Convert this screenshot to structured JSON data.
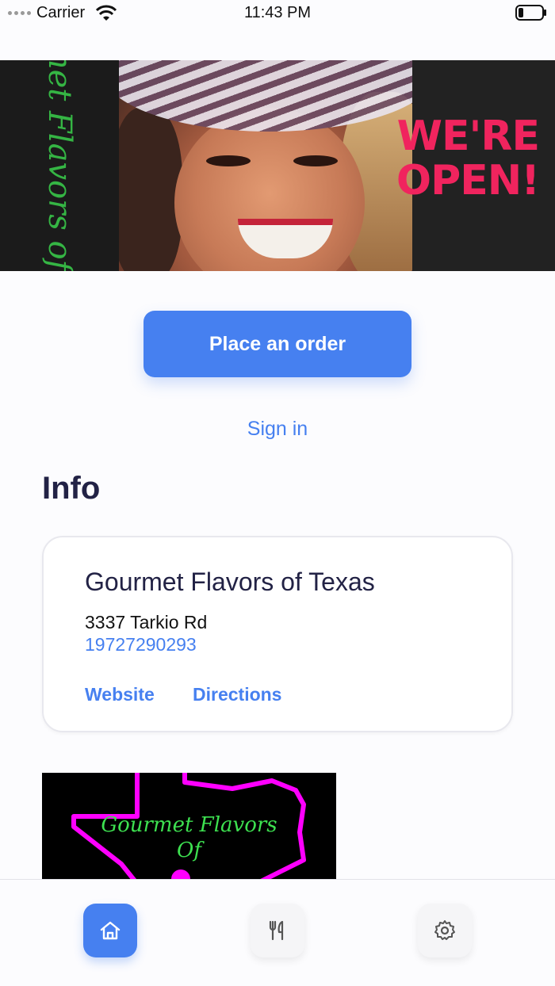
{
  "status_bar": {
    "carrier": "Carrier",
    "time": "11:43 PM"
  },
  "hero": {
    "script_text": "Gourmet Flavors of Texas",
    "headline_line1": "WE'RE",
    "headline_line2": "OPEN!",
    "headline_color": "#f0245e",
    "script_color": "#35b544"
  },
  "actions": {
    "order_label": "Place an order",
    "signin_label": "Sign in"
  },
  "info": {
    "heading": "Info",
    "name": "Gourmet Flavors of Texas",
    "address": "3337 Tarkio Rd",
    "phone": "19727290293",
    "website_label": "Website",
    "directions_label": "Directions"
  },
  "logo_image": {
    "script_line1": "Gourmet Flavors",
    "script_line2": "Of"
  },
  "tab_bar": {
    "items": [
      {
        "name": "home",
        "icon": "home-icon",
        "active": true
      },
      {
        "name": "menu",
        "icon": "fork-knife-icon",
        "active": false
      },
      {
        "name": "settings",
        "icon": "gear-icon",
        "active": false
      }
    ]
  },
  "colors": {
    "accent": "#4680f0",
    "heading": "#222245"
  }
}
